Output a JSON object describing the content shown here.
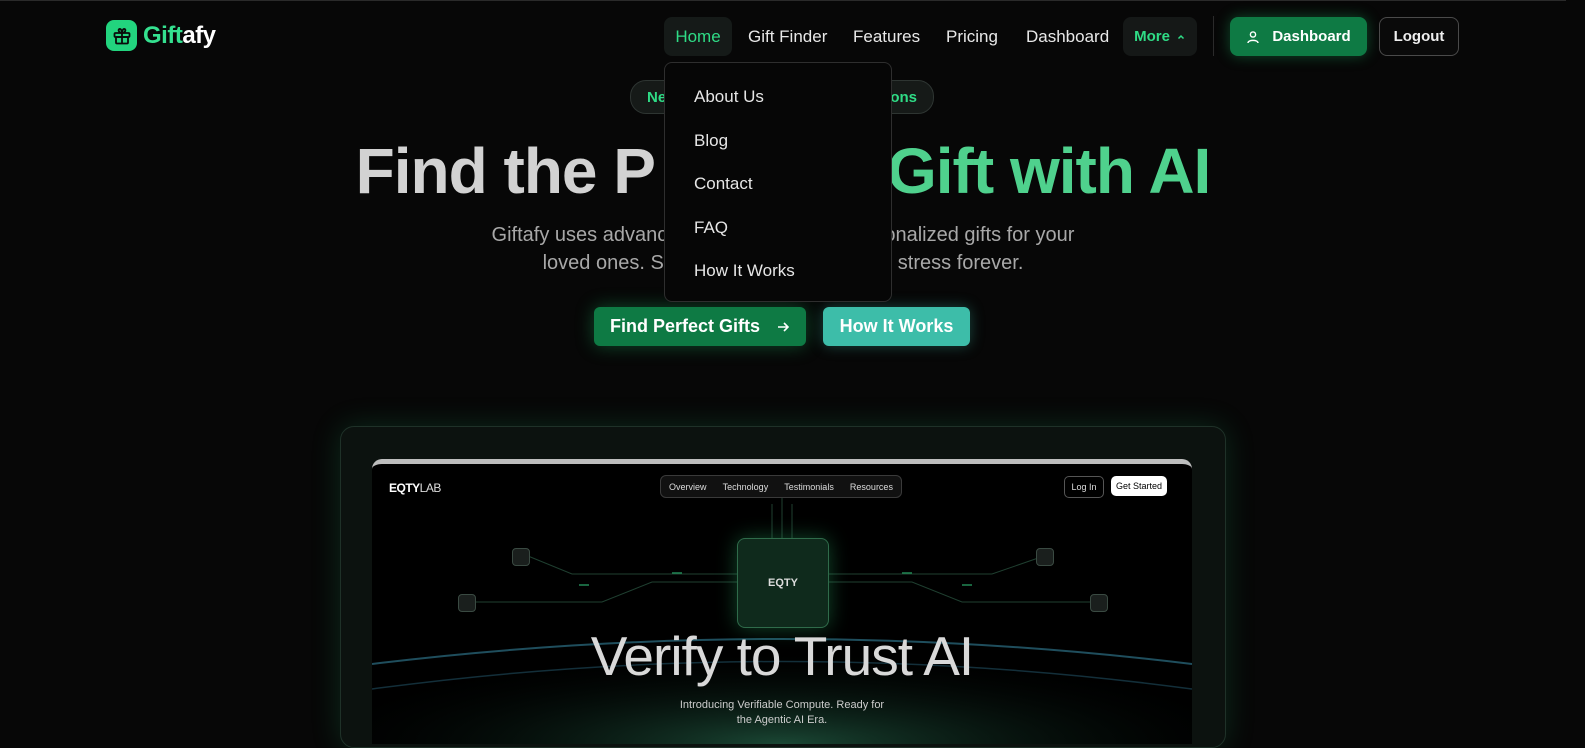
{
  "brand": {
    "name_prefix": "Gift",
    "name_suffix": "afy"
  },
  "nav": {
    "items": [
      "Home",
      "Gift Finder",
      "Features",
      "Pricing",
      "Dashboard"
    ],
    "more_label": "More",
    "dashboard_button": "Dashboard",
    "logout_button": "Logout"
  },
  "dropdown": {
    "items": [
      "About Us",
      "Blog",
      "Contact",
      "FAQ",
      "How It Works"
    ]
  },
  "hero": {
    "badge_left": "Ne",
    "badge_right": "ions",
    "title_left": "Find the P",
    "title_right": "Gift with AI",
    "subtitle_line1_left": "Giftafy uses advance",
    "subtitle_line1_right": "onalized gifts for your",
    "subtitle_line2_left": "loved ones. S",
    "subtitle_line2_right": "stress forever.",
    "primary_cta": "Find Perfect Gifts",
    "secondary_cta": "How It Works"
  },
  "preview": {
    "logo_main": "EQTY",
    "logo_sub": "LAB",
    "nav": [
      "Overview",
      "Technology",
      "Testimonials",
      "Resources"
    ],
    "login": "Log In",
    "get_started": "Get Started",
    "chip_label": "EQTY",
    "title": "Verify to Trust AI",
    "caption_line1": "Introducing Verifiable Compute. Ready for",
    "caption_line2": "the Agentic AI Era."
  },
  "colors": {
    "accent_green": "#2fdc86",
    "primary_button": "#0e7a44",
    "teal_button": "#3dbda9",
    "background": "#070707"
  },
  "icons": {
    "logo": "gift-icon",
    "dashboard": "user-icon",
    "more": "chevron-up-icon",
    "cta": "arrow-right-icon"
  }
}
